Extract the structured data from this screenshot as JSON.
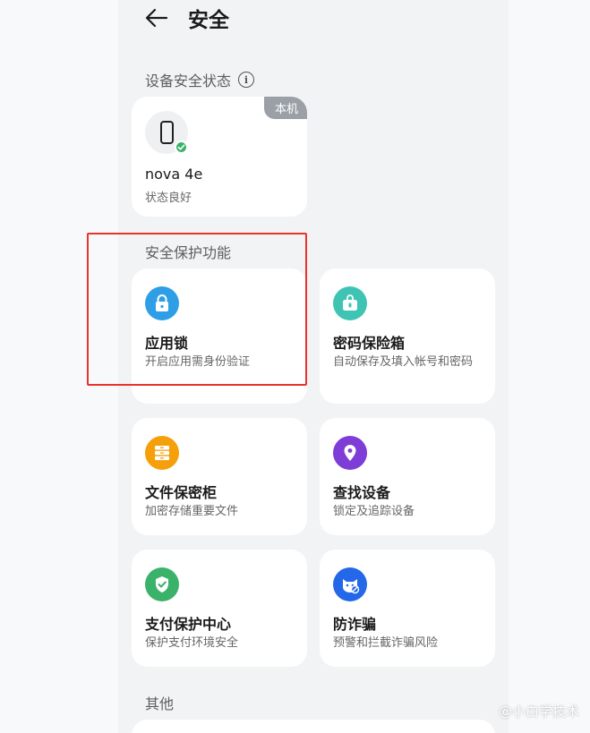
{
  "header": {
    "title": "安全"
  },
  "device_section": {
    "title": "设备安全状态",
    "card": {
      "badge": "本机",
      "name": "nova 4e",
      "status": "状态良好"
    }
  },
  "protection_section": {
    "title": "安全保护功能",
    "items": [
      {
        "title": "应用锁",
        "desc": "开启应用需身份验证",
        "icon": "lock-icon",
        "color": "#2e9ee6"
      },
      {
        "title": "密码保险箱",
        "desc": "自动保存及填入帐号和密码",
        "icon": "lock-icon",
        "color": "#3fc4b4"
      },
      {
        "title": "文件保密柜",
        "desc": "加密存储重要文件",
        "icon": "cabinet-icon",
        "color": "#f5a00a"
      },
      {
        "title": "查找设备",
        "desc": "锁定及追踪设备",
        "icon": "location-pin-icon",
        "color": "#7d3dd6"
      },
      {
        "title": "支付保护中心",
        "desc": "保护支付环境安全",
        "icon": "shield-check-icon",
        "color": "#3bb26a"
      },
      {
        "title": "防诈骗",
        "desc": "预警和拦截诈骗风险",
        "icon": "anti-fraud-icon",
        "color": "#2467e8"
      }
    ]
  },
  "other_section": {
    "title": "其他"
  },
  "watermark": "@小白学技术",
  "colors": {
    "highlight": "#e8332e",
    "card": "#ffffff",
    "page": "#f1f3f5"
  }
}
